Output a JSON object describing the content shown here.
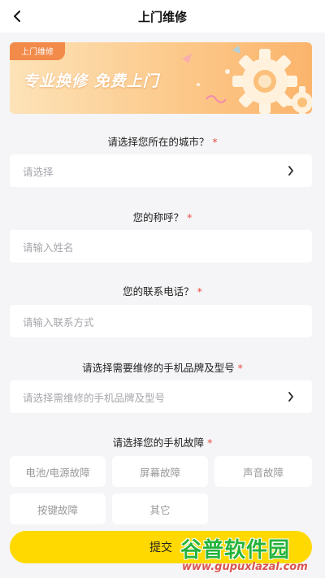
{
  "header": {
    "title": "上门维修",
    "back_icon": "back-chevron-icon"
  },
  "banner": {
    "tag": "上门维修",
    "slogan": "专业换修 免费上门"
  },
  "questions": {
    "city": {
      "label": "请选择您所在的城市？",
      "placeholder": "请选择"
    },
    "name": {
      "label": "您的称呼？",
      "placeholder": "请输入姓名"
    },
    "phone": {
      "label": "您的联系电话？",
      "placeholder": "请输入联系方式"
    },
    "model": {
      "label": "请选择需要维修的手机品牌及型号",
      "placeholder": "请选择需维修的手机品牌及型号"
    },
    "fault": {
      "label": "请选择您的手机故障"
    }
  },
  "required_mark": "*",
  "faults": [
    "电池/电源故障",
    "屏幕故障",
    "声音故障",
    "按键故障",
    "其它"
  ],
  "submit_label": "提交",
  "watermark": {
    "logo": "谷普软件园",
    "url": "www.gupuxlazal.com"
  },
  "colors": {
    "accent": "#ffd900",
    "required": "#e84a3a",
    "banner_tag": "#f28a4a"
  }
}
